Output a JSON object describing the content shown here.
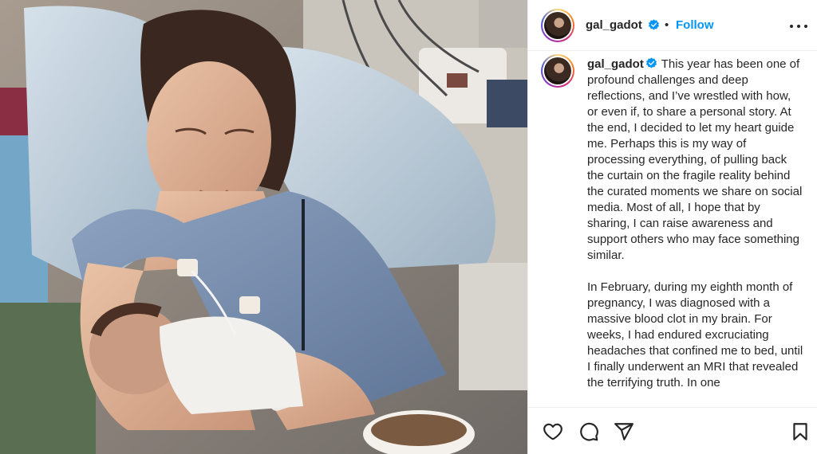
{
  "post": {
    "username": "gal_gadot",
    "separator": "•",
    "follow_label": "Follow",
    "caption_paragraphs": [
      "This year has been one of profound challenges and deep reflections, and I’ve wrestled with how, or even if, to share a personal story. At the end, I decided to let my heart guide me. Perhaps this is my way of processing everything, of pulling back the curtain on the fragile reality behind the curated moments we share on social media. Most of all, I hope that by sharing, I can raise awareness and support others who may face something similar.",
      "In February, during my eighth month of pregnancy, I was diagnosed with a massive blood clot in my brain. For weeks, I had endured excruciating headaches that confined me to bed, until I finally underwent an MRI that revealed the terrifying truth. In one"
    ]
  },
  "icons": {
    "verified": "verified-badge-icon",
    "more": "more-options-icon",
    "like": "heart-icon",
    "comment": "comment-bubble-icon",
    "share": "paper-plane-icon",
    "save": "bookmark-icon"
  },
  "colors": {
    "link_blue": "#0095f6",
    "verified_blue": "#0095f6",
    "text": "#262626",
    "divider": "#efefef"
  }
}
